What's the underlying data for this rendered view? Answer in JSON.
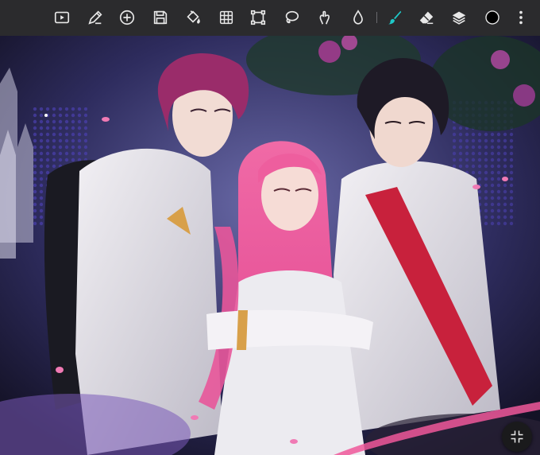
{
  "toolbar": {
    "tools": [
      {
        "id": "record",
        "icon": "video-record-icon"
      },
      {
        "id": "adjust",
        "icon": "pen-settings-icon"
      },
      {
        "id": "add",
        "icon": "add-circle-icon"
      },
      {
        "id": "save",
        "icon": "save-icon"
      },
      {
        "id": "fill",
        "icon": "paint-bucket-icon"
      },
      {
        "id": "grid",
        "icon": "grid-icon"
      },
      {
        "id": "transform",
        "icon": "transform-icon"
      },
      {
        "id": "lasso",
        "icon": "lasso-icon"
      },
      {
        "id": "smudge",
        "icon": "smudge-icon"
      },
      {
        "id": "blur",
        "icon": "water-drop-icon"
      },
      {
        "id": "brush",
        "icon": "brush-icon",
        "active": true
      },
      {
        "id": "eraser",
        "icon": "eraser-icon"
      },
      {
        "id": "layers",
        "icon": "layers-icon"
      },
      {
        "id": "color",
        "icon": "color-swatch-icon"
      },
      {
        "id": "more",
        "icon": "more-vertical-icon"
      }
    ],
    "active_color": "#1ec8c8",
    "current_color": "#000000"
  },
  "canvas": {
    "artwork": "digital-illustration"
  },
  "fab": {
    "icon": "collapse-fullscreen-icon"
  }
}
